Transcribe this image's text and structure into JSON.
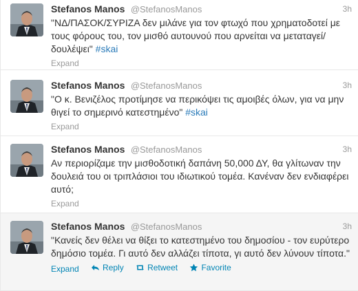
{
  "tweets": [
    {
      "fullname": "Stefanos Manos",
      "username": "@StefanosManos",
      "time": "3h",
      "text": "\"ΝΔ/ΠΑΣΟΚ/ΣΥΡΙΖΑ δεν μιλάνε για τον φτωχό που χρηματοδοτεί με τους φόρους του, τον μισθό αυτουνού που αρνείται να μεταταγεί/δουλέψει\" ",
      "hashtag": "#skai",
      "expand": "Expand"
    },
    {
      "fullname": "Stefanos Manos",
      "username": "@StefanosManos",
      "time": "3h",
      "text": "\"Ο κ. Βενιζέλος προτίμησε να περικόψει τις αμοιβές όλων, για να μην θιγεί το σημερινό κατεστημένο\" ",
      "hashtag": "#skai",
      "expand": "Expand"
    },
    {
      "fullname": "Stefanos Manos",
      "username": "@StefanosManos",
      "time": "3h",
      "text": "Αν περιορίζαμε την μισθοδοτική δαπάνη 50,000 ΔΥ, θα γλίτωναν την δουλειά του οι τριπλάσιοι του ιδιωτικού τομέα. Κανέναν δεν ενδιαφέρει αυτό;",
      "hashtag": "",
      "expand": "Expand"
    },
    {
      "fullname": "Stefanos Manos",
      "username": "@StefanosManos",
      "time": "3h",
      "text": "\"Κανείς δεν θέλει να θίξει το κατεστημένο του δημοσίου - τον ευρύτερο δημόσιο τομέα. Γι αυτό δεν αλλάζει τίποτα, γι αυτό δεν λύνουν τίποτα.\"",
      "hashtag": "",
      "expand": "Expand",
      "reply": "Reply",
      "retweet": "Retweet",
      "favorite": "Favorite"
    }
  ],
  "colors": {
    "link": "#0084b4",
    "hashtag": "#2b7bb9",
    "muted": "#999999",
    "hover_bg": "#f5f5f5"
  }
}
